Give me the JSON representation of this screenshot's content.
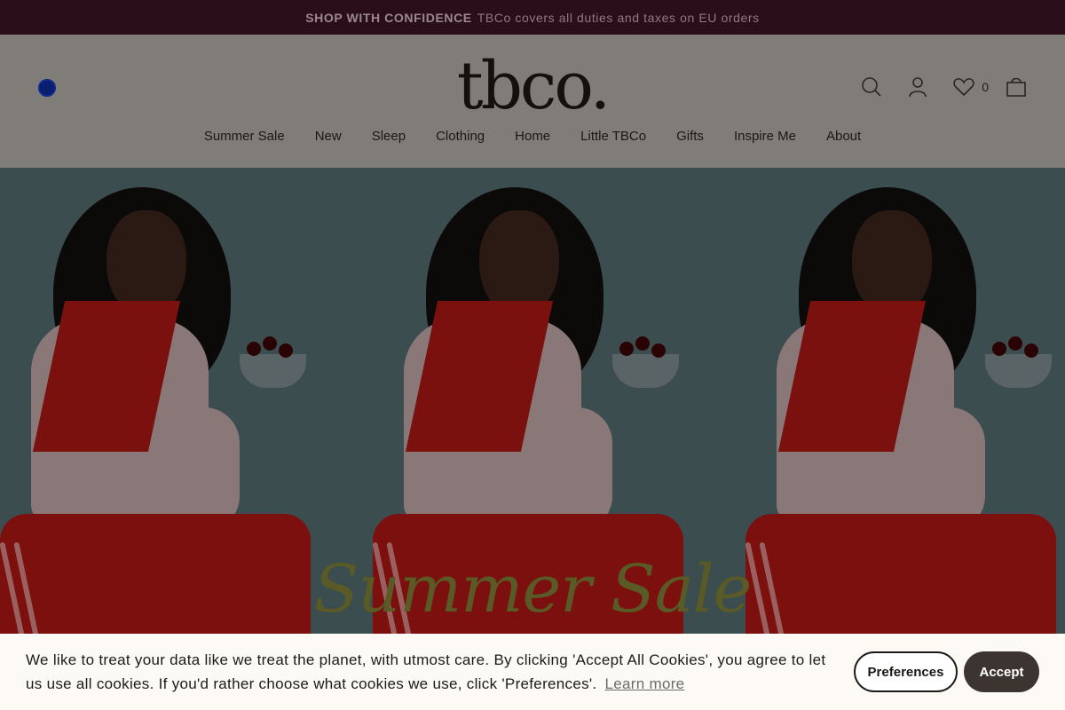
{
  "announcement": {
    "bold": "SHOP WITH CONFIDENCE",
    "text": "TBCo covers all duties and taxes on EU orders"
  },
  "header": {
    "logo": "tbco.",
    "wishlist_count": "0",
    "nav": [
      "Summer Sale",
      "New",
      "Sleep",
      "Clothing",
      "Home",
      "Little TBCo",
      "Gifts",
      "Inspire Me",
      "About"
    ],
    "icons": [
      "flag-icon",
      "search-icon",
      "account-icon",
      "heart-icon",
      "bag-icon"
    ]
  },
  "hero": {
    "title": "Summer Sale"
  },
  "cookie_banner": {
    "text": "We like to treat your data like we treat the planet, with utmost care. By clicking 'Accept All Cookies', you agree to let us use all cookies. If you'd rather choose what cookies we use, click 'Preferences'.",
    "learn_more": "Learn more",
    "preferences_label": "Preferences",
    "accept_label": "Accept"
  }
}
